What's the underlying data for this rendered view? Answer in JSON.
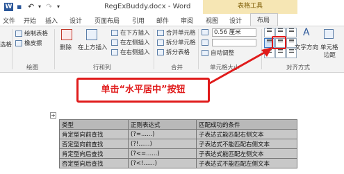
{
  "window": {
    "doc_title": "RegExBuddy.docx - Word",
    "table_tools": "表格工具"
  },
  "tabs": [
    "文件",
    "开始",
    "插入",
    "设计",
    "页面布局",
    "引用",
    "邮件",
    "审阅",
    "视图",
    "设计",
    "布局"
  ],
  "ribbon": {
    "left_partial": "选格",
    "draw": {
      "draw_table": "绘制表格",
      "eraser": "橡皮擦",
      "label": "绘图"
    },
    "delete": "删除",
    "insert_above": "在上方插入",
    "insert_below": "在下方插入",
    "insert_left": "在左侧插入",
    "insert_right": "在右侧插入",
    "rows_cols_label": "行和列",
    "merge_cells": "合并单元格",
    "split_cells": "拆分单元格",
    "split_table": "拆分表格",
    "merge_label": "合并",
    "height_value": "0.56 厘米",
    "autofit": "自动调整",
    "cell_size_label": "单元格大小",
    "text_direction": "文字方向",
    "cell_margins_1": "单元格",
    "cell_margins_2": "边距",
    "alignment_label": "对齐方式"
  },
  "callout": "单击“水平居中”按钮",
  "table": {
    "rows": [
      [
        "类型",
        "正则表达式",
        "匹配成功的条件"
      ],
      [
        "肯定型向前查找",
        "(?=......)",
        "子表达式能匹配右侧文本"
      ],
      [
        "否定型向前查找",
        "(?!......)",
        "子表达式不能匹配右侧文本"
      ],
      [
        "肯定型向后查找",
        "(?<=......)",
        "子表达式能匹配左侧文本"
      ],
      [
        "否定型向后查找",
        "(?<!......)",
        "子表达式不能匹配左侧文本"
      ]
    ]
  },
  "colors": {
    "callout_red": "#e01b1b",
    "word_blue": "#2b579a",
    "table_header_bg": "#b9b9b9"
  }
}
